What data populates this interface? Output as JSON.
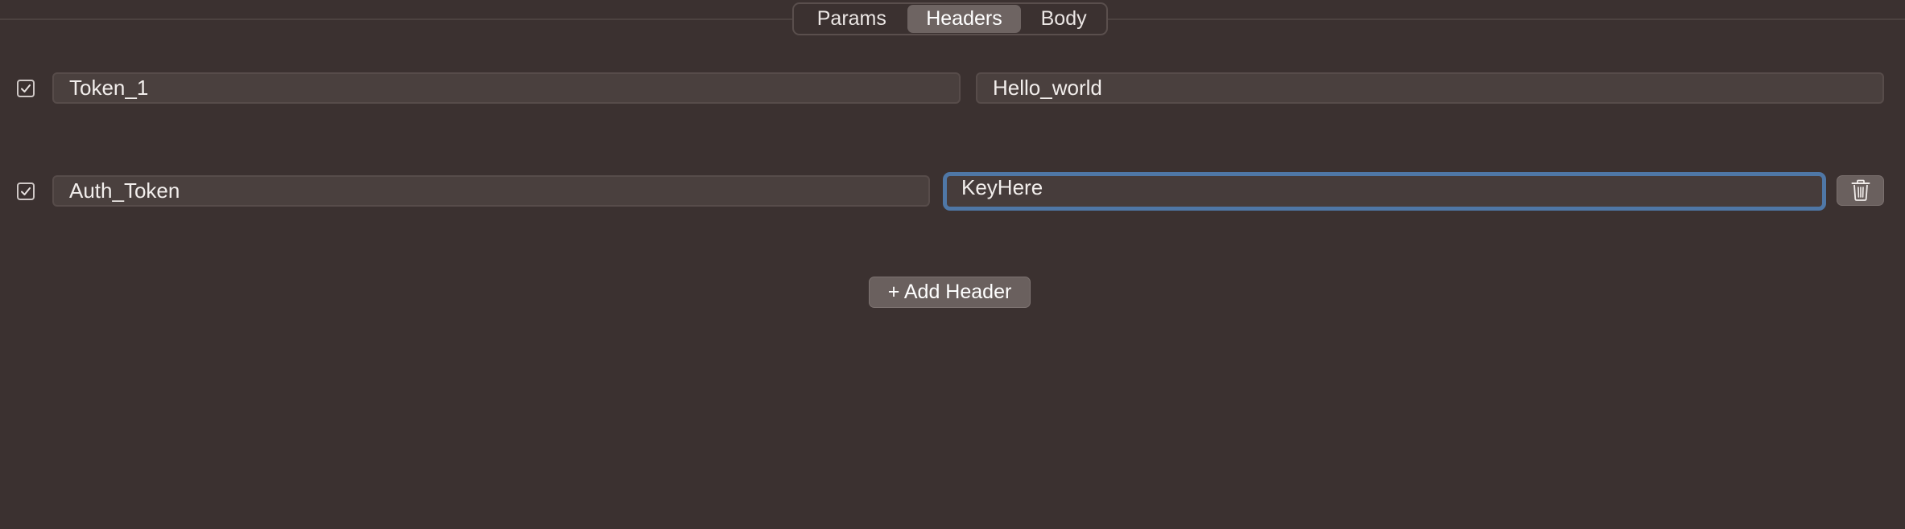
{
  "tabs": {
    "params": "Params",
    "headers": "Headers",
    "body": "Body",
    "selected": "Headers"
  },
  "headers": [
    {
      "enabled": true,
      "key": "Token_1",
      "value": "Hello_world"
    },
    {
      "enabled": true,
      "key": "Auth_Token",
      "value": "KeyHere",
      "focused": true
    }
  ],
  "add_button_label": "+ Add Header",
  "colors": {
    "background": "#3b3130",
    "focus_ring": "#4f77a6",
    "selected_tab": "#6e6462"
  },
  "icons": {
    "checkbox": "checkmark-icon",
    "delete": "trash-icon"
  }
}
